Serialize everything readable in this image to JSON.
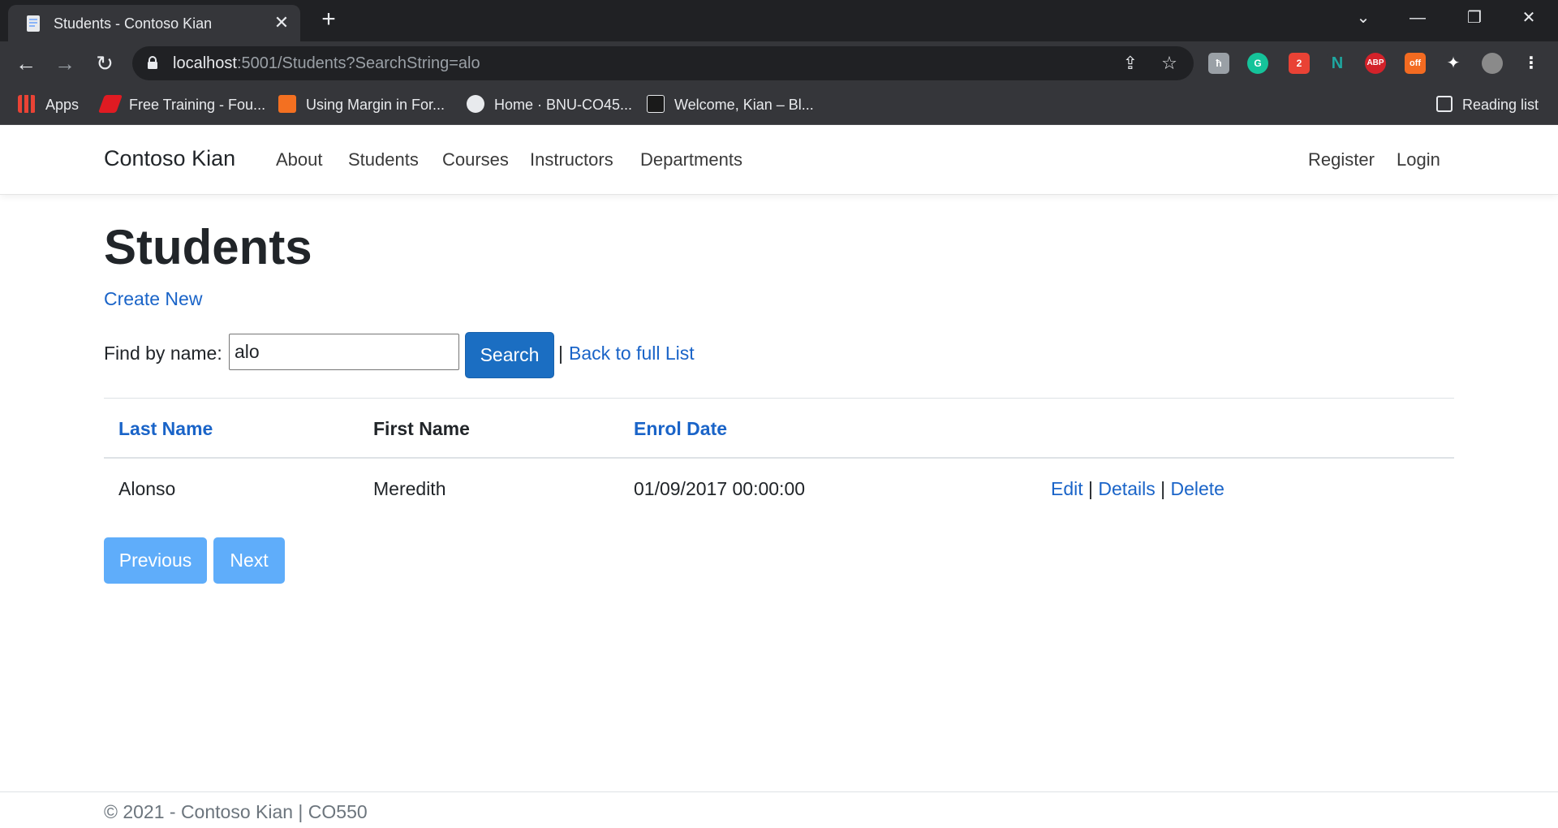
{
  "browser": {
    "tab_title": "Students - Contoso Kian",
    "url_host": "localhost",
    "url_rest": ":5001/Students?SearchString=alo",
    "bookmarks": [
      {
        "label": "Apps",
        "icon": "apps-grid-icon"
      },
      {
        "label": "Free Training - Fou...",
        "icon": "red-arrow-icon"
      },
      {
        "label": "Using Margin in For...",
        "icon": "dfx-icon"
      },
      {
        "label": "Home · BNU-CO45...",
        "icon": "github-icon"
      },
      {
        "label": "Welcome, Kian – Bl...",
        "icon": "blackboard-icon"
      }
    ],
    "reading_list": "Reading list",
    "extensions": [
      {
        "name": "ext-grey",
        "text": "ħ",
        "color": "#9aa0a6"
      },
      {
        "name": "grammarly",
        "text": "G",
        "color": "#15c39a"
      },
      {
        "name": "ext-colorful",
        "text": "2",
        "color": "#e94235"
      },
      {
        "name": "ext-n",
        "text": "N",
        "color": "#1ea7a0"
      },
      {
        "name": "adblock-plus",
        "text": "ABP",
        "color": "#d3222a"
      },
      {
        "name": "ext-off",
        "text": "off",
        "color": "#f36b21"
      }
    ]
  },
  "nav": {
    "brand": "Contoso Kian",
    "links": [
      "About",
      "Students",
      "Courses",
      "Instructors",
      "Departments"
    ],
    "register": "Register",
    "login": "Login"
  },
  "page": {
    "title": "Students",
    "create_new": "Create New",
    "find_label": "Find by name:",
    "search_value": "alo",
    "search_button": "Search",
    "separator": "|",
    "back_link": "Back to full List"
  },
  "table": {
    "headers": [
      "Last Name",
      "First Name",
      "Enrol Date"
    ],
    "rows": [
      {
        "last_name": "Alonso",
        "first_name": "Meredith",
        "enrol_date": "01/09/2017 00:00:00"
      }
    ],
    "actions": [
      "Edit",
      "Details",
      "Delete"
    ]
  },
  "pager": {
    "previous": "Previous",
    "next": "Next"
  },
  "footer": {
    "text": "© 2021 - Contoso Kian | CO550"
  },
  "colors": {
    "link": "#1a64c8",
    "primary_button": "#1b6ec2",
    "disabled_pager_button": "#5fadfa"
  }
}
